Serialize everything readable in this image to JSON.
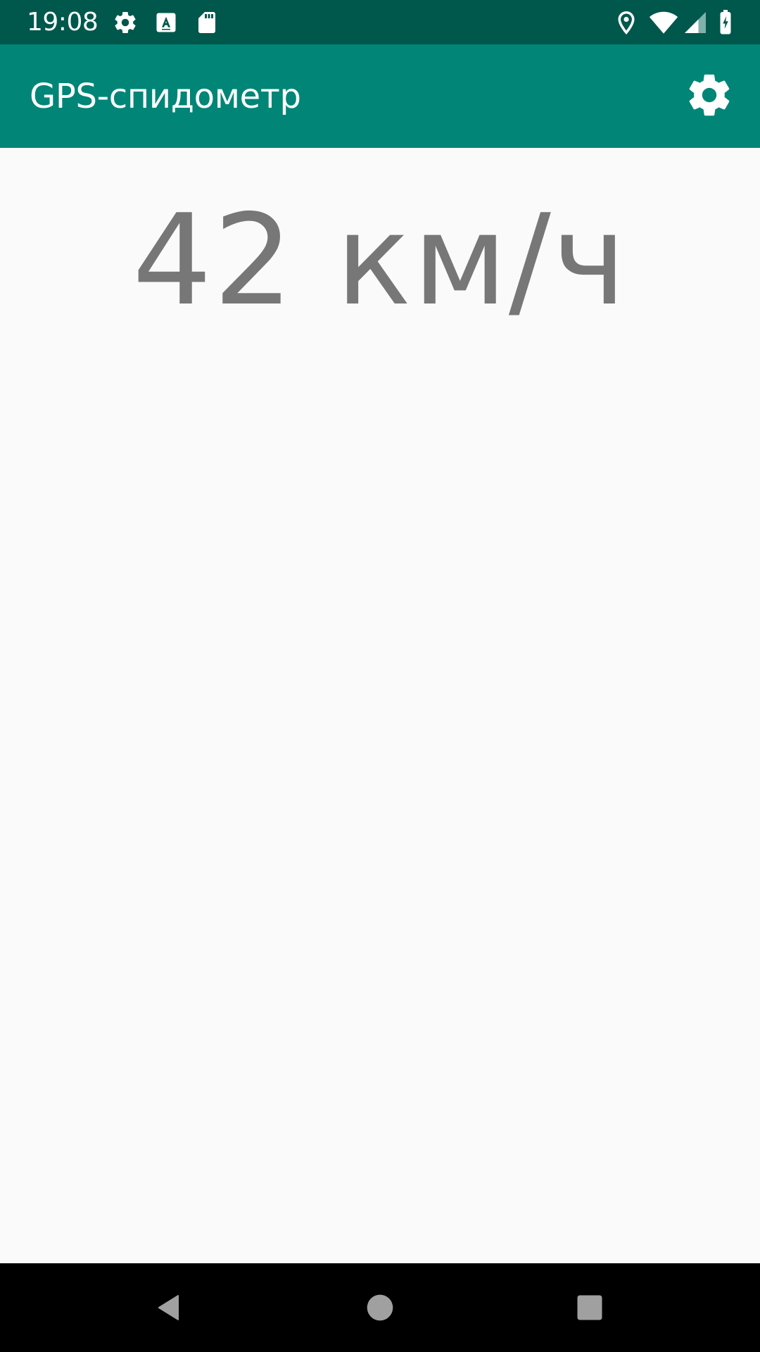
{
  "status_bar": {
    "time": "19:08",
    "icons": [
      "gear-icon",
      "text-a-icon",
      "sd-card-icon",
      "location-icon",
      "wifi-icon",
      "cell-signal-icon",
      "battery-charging-icon"
    ]
  },
  "app_bar": {
    "title": "GPS-спидометр",
    "action_icon": "settings-icon"
  },
  "main": {
    "speed_text": "42 км/ч"
  },
  "nav_bar": {
    "buttons": [
      "back-icon",
      "home-icon",
      "recents-icon"
    ]
  },
  "colors": {
    "status_bar": "#00574b",
    "app_bar": "#008577",
    "background": "#fafafa",
    "speed_text": "#777777",
    "nav_bar": "#000000"
  }
}
